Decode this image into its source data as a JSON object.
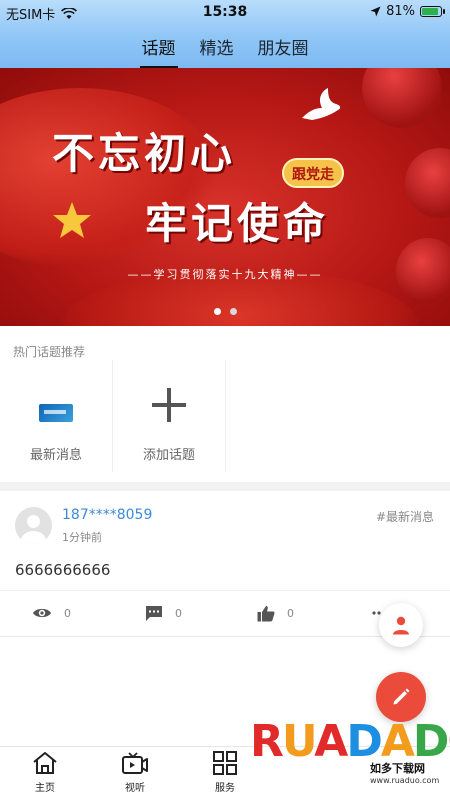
{
  "status_bar": {
    "carrier": "无SIM卡",
    "time": "15:38",
    "battery": "81%",
    "battery_level": 0.81,
    "icons": [
      "wifi-icon",
      "location-arrow-icon",
      "battery-icon"
    ]
  },
  "tabs": [
    {
      "label": "话题",
      "active": true
    },
    {
      "label": "精选",
      "active": false
    },
    {
      "label": "朋友圈",
      "active": false
    }
  ],
  "banner": {
    "line1": "不忘初心",
    "line2": "牢记使命",
    "badge": "跟党走",
    "subtitle": "——学习贯彻落实十九大精神——",
    "slide_count": 2,
    "active_slide": 1
  },
  "hot_topics": {
    "title": "热门话题推荐",
    "items": [
      {
        "label": "最新消息",
        "icon": "news-thumbnail"
      },
      {
        "label": "添加话题",
        "icon": "plus-icon"
      }
    ]
  },
  "post": {
    "username": "187****8059",
    "time": "1分钟前",
    "tag": "#最新消息",
    "content": "6666666666",
    "views": "0",
    "comments": "0",
    "likes": "0"
  },
  "bottom_nav": [
    {
      "label": "主页",
      "icon": "home-icon"
    },
    {
      "label": "视听",
      "icon": "video-icon"
    },
    {
      "label": "服务",
      "icon": "grid-icon"
    }
  ],
  "watermark": {
    "logo": "RUADADO",
    "chinese": "如多下载网",
    "url": "www.ruaduo.com"
  },
  "colors": {
    "accent_red": "#ea4b3a",
    "username_blue": "#3b8ad9",
    "topbar_blue": "#8fc6f6"
  }
}
